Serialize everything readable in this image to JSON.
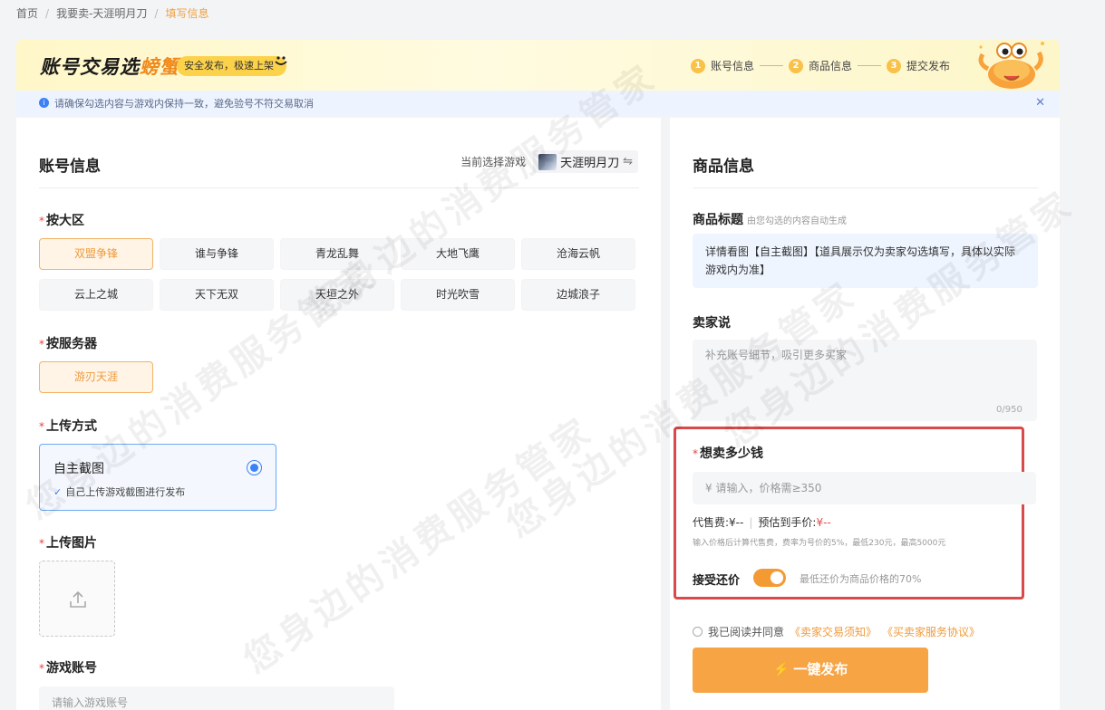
{
  "breadcrumb": {
    "items": [
      "首页",
      "我要卖-天涯明月刀"
    ],
    "current": "填写信息"
  },
  "banner": {
    "brand_prefix": "账号交易选",
    "brand_highlight": "螃蟹",
    "slogan": "安全发布，极速上架",
    "steps": [
      {
        "num": "1",
        "label": "账号信息"
      },
      {
        "num": "2",
        "label": "商品信息"
      },
      {
        "num": "3",
        "label": "提交发布"
      }
    ]
  },
  "notice": {
    "text": "请确保勾选内容与游戏内保持一致，避免验号不符交易取消",
    "close_icon": "close-icon"
  },
  "account": {
    "title": "账号信息",
    "current_game_label": "当前选择游戏",
    "current_game": "天涯明月刀",
    "switch_icon": "⇋",
    "region_label": "按大区",
    "regions": [
      "双盟争锋",
      "谁与争锋",
      "青龙乱舞",
      "大地飞鹰",
      "沧海云帆",
      "云上之城",
      "天下无双",
      "天垣之外",
      "时光吹雪",
      "边城浪子"
    ],
    "selected_region": "双盟争锋",
    "server_label": "按服务器",
    "servers": [
      "游刃天涯"
    ],
    "selected_server": "游刃天涯",
    "upload_method_label": "上传方式",
    "upload_method": {
      "title": "自主截图",
      "desc": "自己上传游戏截图进行发布"
    },
    "upload_image_label": "上传图片",
    "game_account_label": "游戏账号",
    "game_account_placeholder": "请输入游戏账号"
  },
  "product": {
    "title": "商品信息",
    "product_title_label": "商品标题",
    "product_title_hint": "由您勾选的内容自动生成",
    "product_title_value": "详情看图【自主截图】【道具展示仅为卖家勾选填写，具体以实际游戏内为准】",
    "seller_says_label": "卖家说",
    "seller_says_placeholder": "补充账号细节，吸引更多买家",
    "seller_says_counter": "0/950",
    "price_label": "想卖多少钱",
    "price_placeholder": "¥ 请输入，价格需≥350",
    "fee_label": "代售费:",
    "fee_value": "¥--",
    "estimate_label": "预估到手价:",
    "estimate_value": "¥--",
    "fee_note": "输入价格后计算代售费，费率为号价的5%，最低230元，最高5000元",
    "bargain_label": "接受还价",
    "bargain_enabled": true,
    "bargain_note": "最低还价为商品价格的70%",
    "agree_prefix": "我已阅读并同意",
    "agree_link1": "《卖家交易须知》",
    "agree_link2": "《买卖家服务协议》",
    "publish_label": "一键发布"
  },
  "watermark": "您身边的消费服务管家",
  "colors": {
    "accent": "#f6a444",
    "selected_chip_text": "#ef9a3c",
    "highlight_border": "#d94a4a",
    "info_blue": "#3b82f6"
  }
}
